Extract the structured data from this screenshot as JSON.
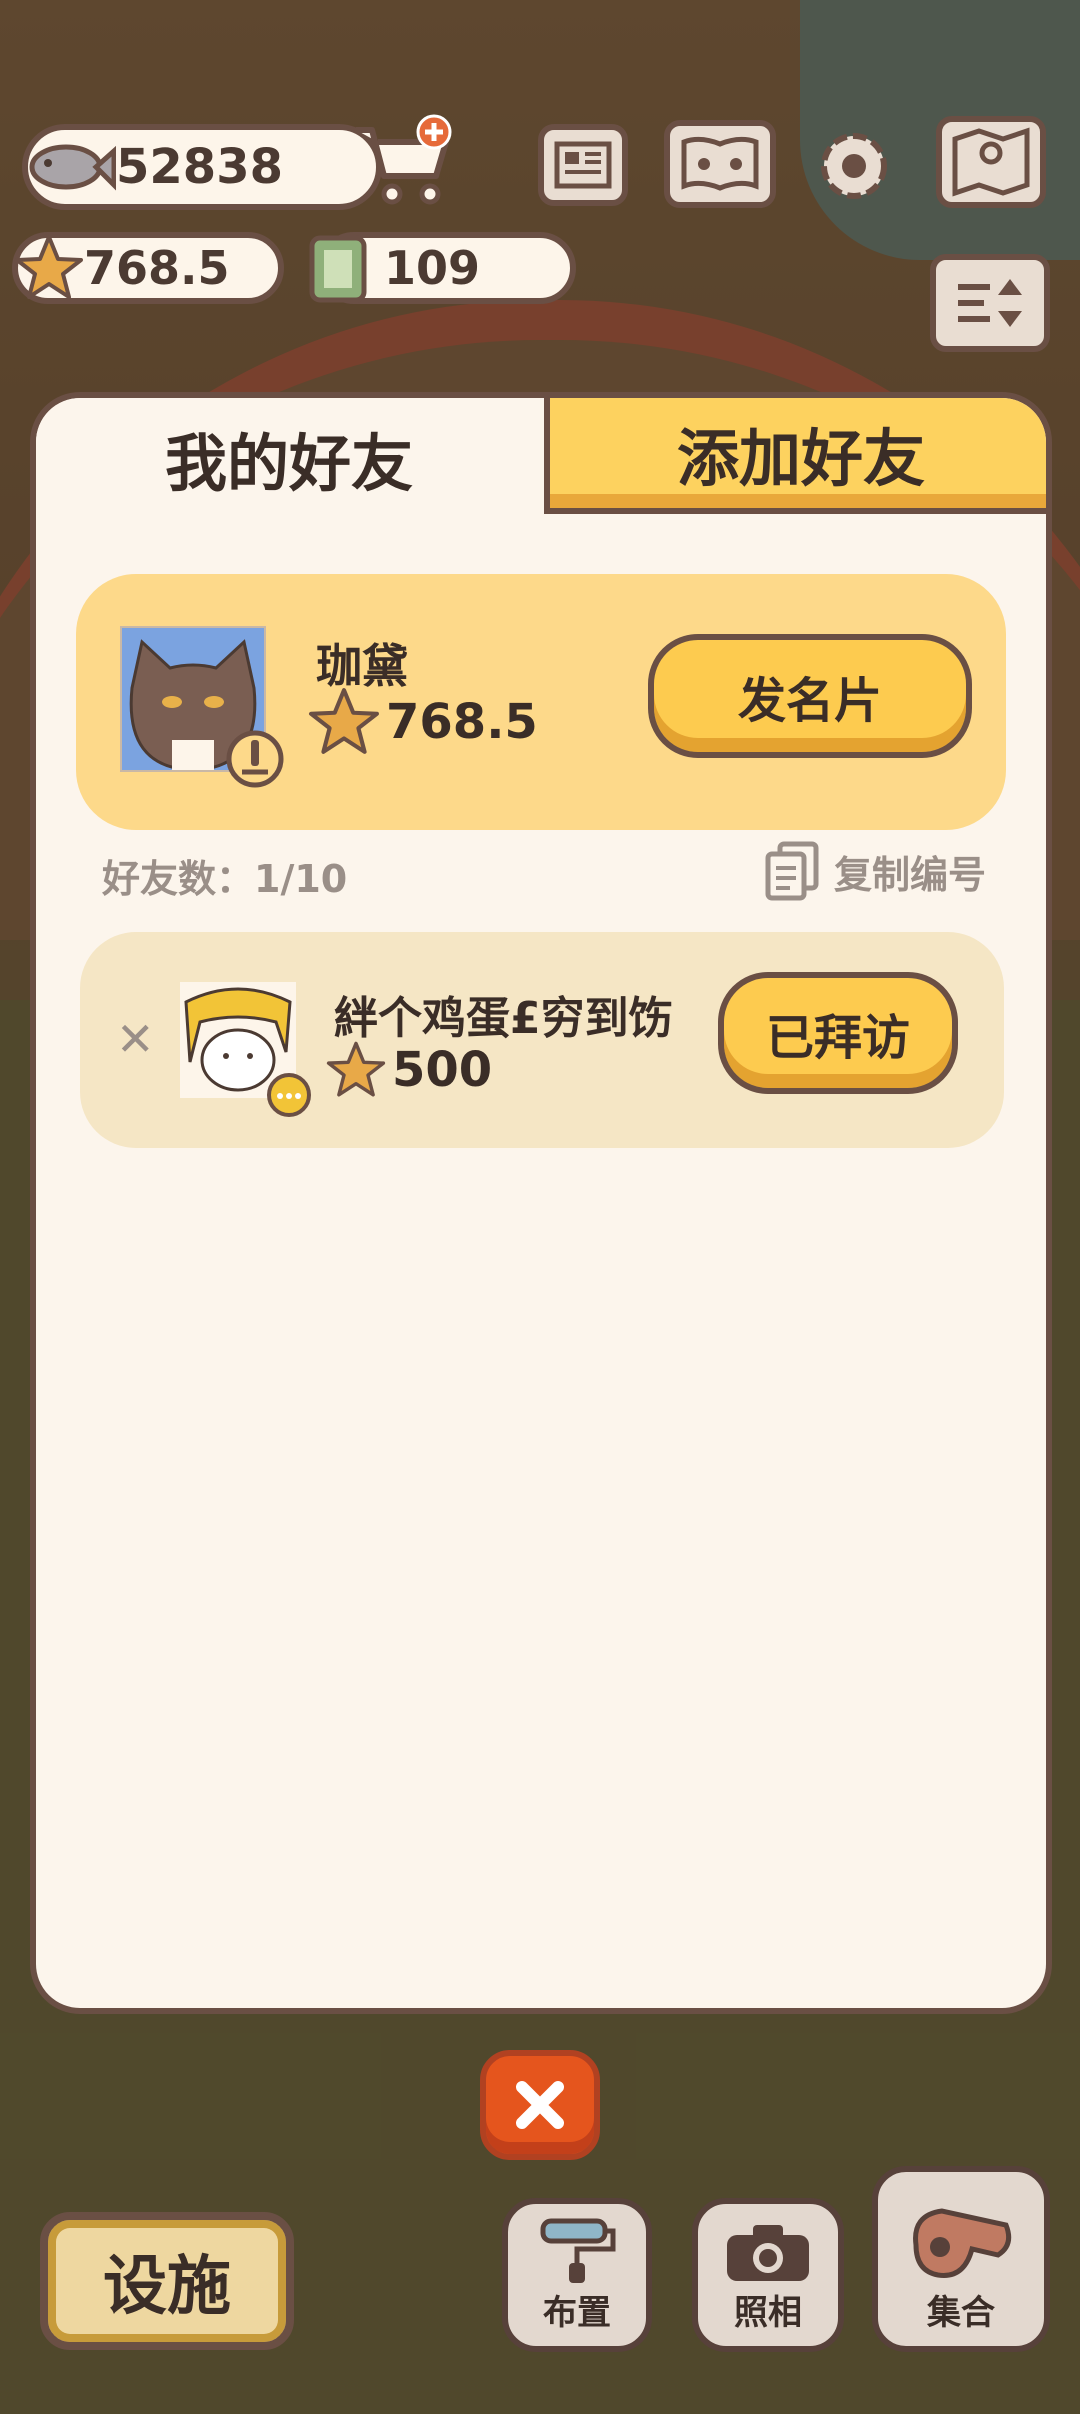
{
  "hud": {
    "fish_count": "52838",
    "stars": "768.5",
    "tickets": "109"
  },
  "tabs": {
    "my_friends": "我的好友",
    "add_friend": "添加好友"
  },
  "my_card": {
    "name": "珈黛",
    "score": "768.5",
    "send_card_label": "发名片"
  },
  "friend_count": "好友数：1/10",
  "copy_id_label": "复制编号",
  "friends": [
    {
      "name": "絆个鸡蛋£穷到饬",
      "score": "500",
      "visit_label": "已拜访"
    }
  ],
  "bottom": {
    "facility_label": "设施",
    "layout_label": "布置",
    "photo_label": "照相",
    "gather_label": "集合"
  },
  "colors": {
    "panel_bg": "#fcf5ec",
    "accent_yellow": "#fdcb4f",
    "border_brown": "#6a4f44",
    "close_orange": "#e5551d"
  }
}
